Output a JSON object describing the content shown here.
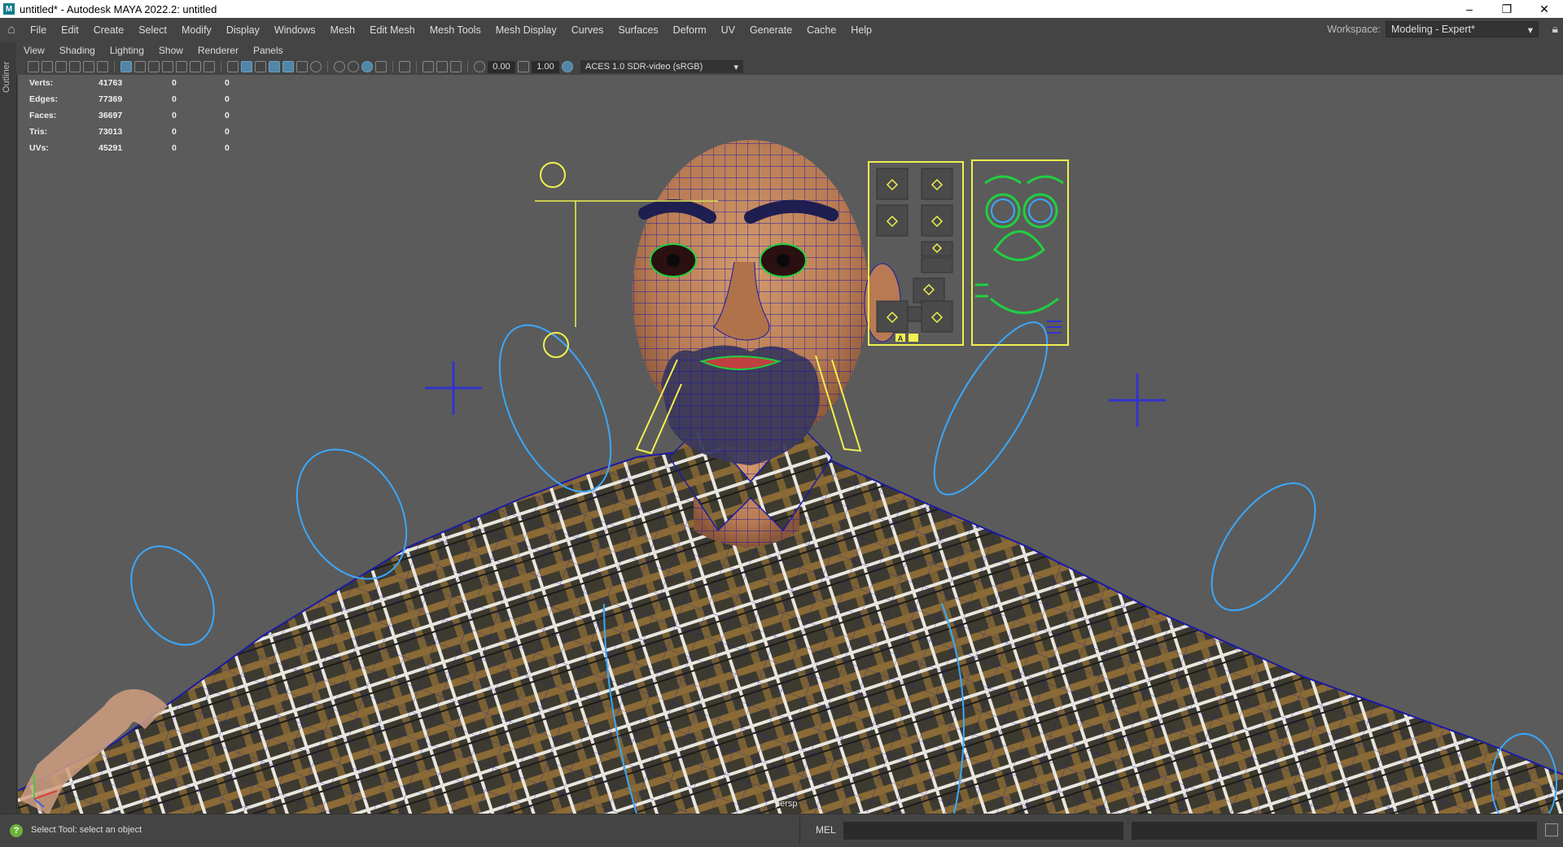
{
  "window": {
    "icon_letter": "M",
    "title": "untitled* - Autodesk MAYA 2022.2: untitled",
    "controls": {
      "minimize": "–",
      "restore": "❐",
      "close": "✕"
    }
  },
  "menubar": {
    "items": [
      "File",
      "Edit",
      "Create",
      "Select",
      "Modify",
      "Display",
      "Windows",
      "Mesh",
      "Edit Mesh",
      "Mesh Tools",
      "Mesh Display",
      "Curves",
      "Surfaces",
      "Deform",
      "UV",
      "Generate",
      "Cache",
      "Help"
    ],
    "workspace_label": "Workspace:",
    "workspace_value": "Modeling - Expert*"
  },
  "outliner": {
    "label": "Outliner"
  },
  "panel_menu": {
    "items": [
      "View",
      "Shading",
      "Lighting",
      "Show",
      "Renderer",
      "Panels"
    ]
  },
  "viewport_toolbar": {
    "exposure": "0.00",
    "gamma": "1.00",
    "color_space": "ACES 1.0 SDR-video (sRGB)"
  },
  "hud": {
    "rows": [
      {
        "label": "Verts:",
        "v1": "41763",
        "v2": "0",
        "v3": "0"
      },
      {
        "label": "Edges:",
        "v1": "77369",
        "v2": "0",
        "v3": "0"
      },
      {
        "label": "Faces:",
        "v1": "36697",
        "v2": "0",
        "v3": "0"
      },
      {
        "label": "Tris:",
        "v1": "73013",
        "v2": "0",
        "v3": "0"
      },
      {
        "label": "UVs:",
        "v1": "45291",
        "v2": "0",
        "v3": "0"
      }
    ]
  },
  "viewport": {
    "camera": "persp"
  },
  "face_panel": {
    "letter_a": "A"
  },
  "statusbar": {
    "help_icon": "?",
    "message": "Select Tool: select an object",
    "mel_label": "MEL"
  },
  "colors": {
    "viewport_bg": "#5b5b5b",
    "wire": "#1a1aa8",
    "control_cyan": "#3aa8ff",
    "control_yellow": "#f0f050",
    "control_green": "#20d040",
    "skin": "#c8885c"
  }
}
